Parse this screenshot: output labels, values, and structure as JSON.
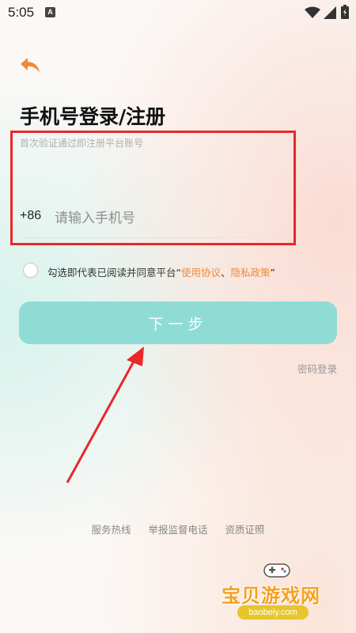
{
  "status_bar": {
    "time": "5:05",
    "notification_icon": "A"
  },
  "header": {
    "back_icon": "back-arrow-icon"
  },
  "login": {
    "title": "手机号登录/注册",
    "subtitle": "首次验证通过即注册平台账号",
    "country_code": "+86",
    "phone_placeholder": "请输入手机号",
    "phone_value": ""
  },
  "agreement": {
    "prefix": "勾选即代表已阅读并同意平台“",
    "terms_link": "使用协议",
    "separator": "、",
    "privacy_link": "隐私政策",
    "suffix": "”",
    "checked": false
  },
  "actions": {
    "next_label": "下一步",
    "password_login_label": "密码登录"
  },
  "footer": {
    "links": [
      "服务热线",
      "举报监督电话",
      "资质证照"
    ]
  },
  "watermark": {
    "name": "宝贝游戏网",
    "url": "baobeiy.com"
  },
  "colors": {
    "accent_orange": "#f08a3a",
    "button_teal": "#8fdcd6",
    "annotation_red": "#e8282a"
  }
}
